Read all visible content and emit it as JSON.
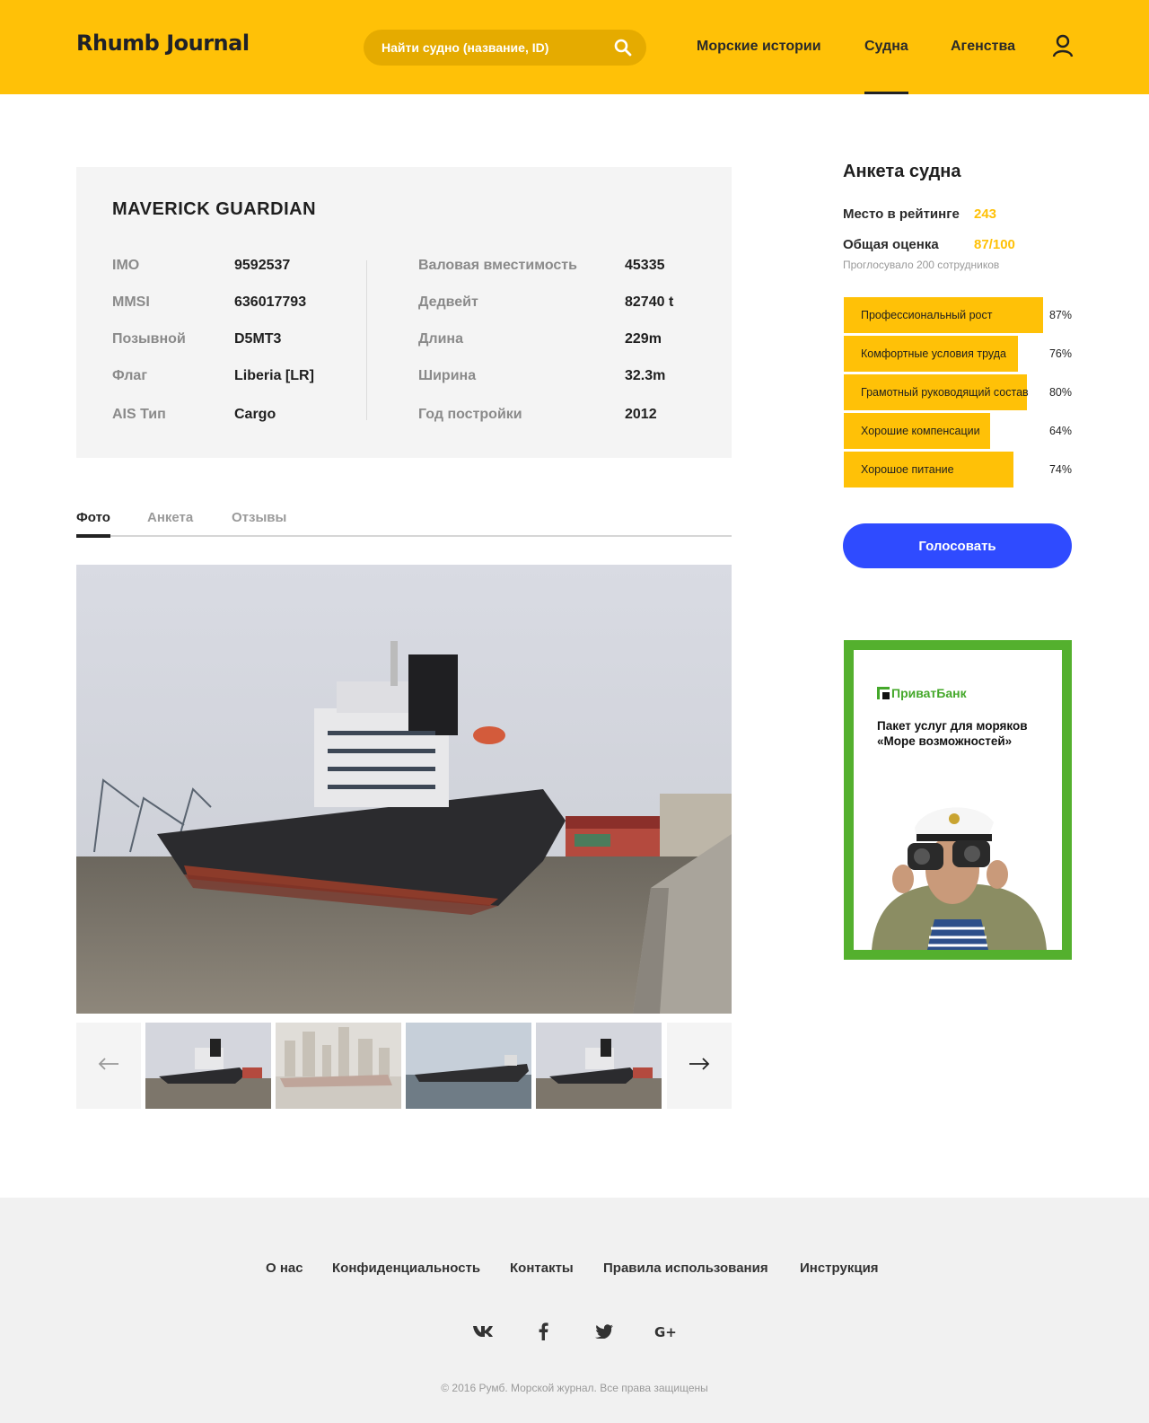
{
  "header": {
    "logo": "Rhumb Journal",
    "search_placeholder": "Найти судно (название, ID)",
    "nav": [
      "Морские истории",
      "Судна",
      "Агенства"
    ],
    "active_nav": "Судна"
  },
  "ship": {
    "name": "MAVERICK GUARDIAN",
    "left_fields": [
      {
        "label": "IMO",
        "value": "9592537"
      },
      {
        "label": "MMSI",
        "value": "636017793"
      },
      {
        "label": "Позывной",
        "value": "D5MT3"
      },
      {
        "label": "Флаг",
        "value": "Liberia [LR]"
      },
      {
        "label": "AIS Тип",
        "value": "Cargo"
      }
    ],
    "right_fields": [
      {
        "label": "Валовая вместимость",
        "value": "45335"
      },
      {
        "label": "Дедвейт",
        "value": "82740 t"
      },
      {
        "label": "Длина",
        "value": "229m"
      },
      {
        "label": "Ширина",
        "value": "32.3m"
      },
      {
        "label": "Год постройки",
        "value": "2012"
      }
    ]
  },
  "tabs": [
    "Фото",
    "Анкета",
    "Отзывы"
  ],
  "active_tab": "Фото",
  "sidebar": {
    "title": "Анкета судна",
    "rank_label": "Место в рейтинге",
    "rank_value": "243",
    "score_label": "Общая оценка",
    "score_value": "87/100",
    "votes_note": "Проглосувало 200 сотрудников",
    "bars": [
      {
        "label": "Профессиональный рост",
        "pct_text": "87%",
        "fraction": 0.87
      },
      {
        "label": "Комфортные условия труда",
        "pct_text": "76%",
        "fraction": 0.76
      },
      {
        "label": "Грамотный руководящий состав",
        "pct_text": "80%",
        "fraction": 0.8
      },
      {
        "label": "Хорошие компенсации",
        "pct_text": "64%",
        "fraction": 0.64
      },
      {
        "label": "Хорошое питание",
        "pct_text": "74%",
        "fraction": 0.74
      }
    ],
    "vote_button": "Голосовать"
  },
  "ad": {
    "brand": "ПриватБанк",
    "text": "Пакет услуг для моряков «Море возможностей»"
  },
  "footer": {
    "links": [
      "О нас",
      "Конфиденциальность",
      "Контакты",
      "Правила использования",
      "Инструкция"
    ],
    "social_icons": [
      "vk-icon",
      "facebook-icon",
      "twitter-icon",
      "google-plus-icon"
    ],
    "copyright": "© 2016 Румб. Морской журнал. Все права защищены"
  },
  "colors": {
    "accent": "#ffc107",
    "button": "#2f4bff",
    "ad_green": "#54b02e"
  }
}
